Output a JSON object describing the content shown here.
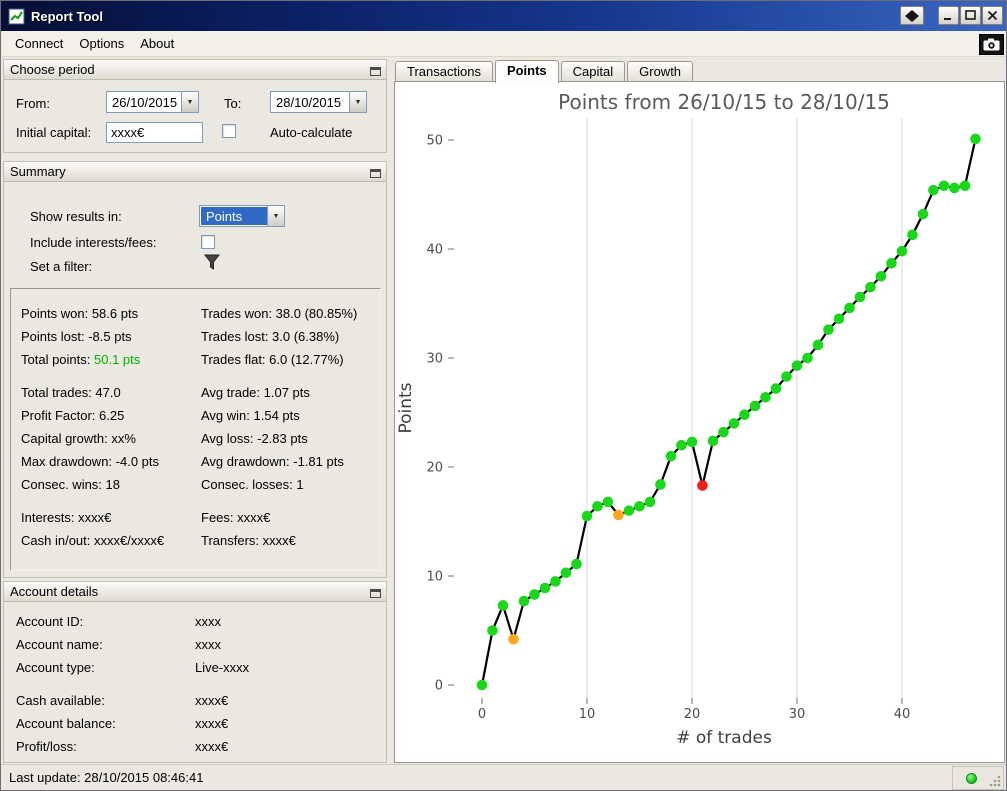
{
  "titlebar": {
    "title": "Report Tool"
  },
  "menubar": {
    "items": [
      "Connect",
      "Options",
      "About"
    ]
  },
  "choose_period": {
    "title": "Choose period",
    "from_label": "From:",
    "from_value": "26/10/2015",
    "to_label": "To:",
    "to_value": "28/10/2015",
    "initial_capital_label": "Initial capital:",
    "initial_capital_value": "xxxx€",
    "auto_calculate_label": "Auto-calculate",
    "auto_calculate_checked": false
  },
  "summary": {
    "title": "Summary",
    "show_results_label": "Show results in:",
    "show_results_value": "Points",
    "include_label": "Include interests/fees:",
    "include_checked": false,
    "filter_label": "Set a filter:",
    "stats_groups": [
      [
        [
          "Points won: 58.6 pts",
          "Trades won: 38.0 (80.85%)"
        ],
        [
          "Points lost: -8.5 pts",
          "Trades lost: 3.0 (6.38%)"
        ],
        [
          {
            "label": "Total points: ",
            "value": "50.1 pts",
            "value_color": "#00b400"
          },
          "Trades flat: 6.0 (12.77%)"
        ]
      ],
      [
        [
          "Total trades: 47.0",
          "Avg trade: 1.07 pts"
        ],
        [
          "Profit Factor: 6.25",
          "Avg win: 1.54 pts"
        ],
        [
          "Capital growth: xx%",
          "Avg loss: -2.83 pts"
        ],
        [
          "Max drawdown: -4.0 pts",
          "Avg drawdown: -1.81 pts"
        ],
        [
          "Consec. wins: 18",
          "Consec. losses: 1"
        ]
      ],
      [
        [
          "Interests: xxxx€",
          "Fees: xxxx€"
        ],
        [
          "Cash in/out: xxxx€/xxxx€",
          "Transfers: xxxx€"
        ]
      ]
    ]
  },
  "account_details": {
    "title": "Account details",
    "groups": [
      [
        {
          "label": "Account ID:",
          "value": "xxxx"
        },
        {
          "label": "Account name:",
          "value": "xxxx"
        },
        {
          "label": "Account type:",
          "value": "Live-xxxx"
        }
      ],
      [
        {
          "label": "Cash available:",
          "value": "xxxx€"
        },
        {
          "label": "Account balance:",
          "value": "xxxx€"
        },
        {
          "label": "Profit/loss:",
          "value": "xxxx€"
        }
      ]
    ]
  },
  "statusbar": {
    "last_update": "Last update: 28/10/2015 08:46:41"
  },
  "tabs": [
    {
      "label": "Transactions",
      "active": false
    },
    {
      "label": "Points",
      "active": true
    },
    {
      "label": "Capital",
      "active": false
    },
    {
      "label": "Growth",
      "active": false
    }
  ],
  "icons": {
    "app": "chart-app-icon",
    "window_extra": "diamond-dock-icon",
    "minimize": "minimize-icon",
    "maximize": "maximize-icon",
    "close": "close-icon",
    "screenshot": "camera-icon",
    "panel_float": "float-panel-icon",
    "dropdown": "chevron-down-icon",
    "filter": "funnel-icon",
    "status_led": "green-led-icon",
    "resize": "resize-grip-icon"
  },
  "colors": {
    "selection_blue": "#316ac5",
    "total_points_green": "#00b400",
    "led_green": "#2ed12e"
  },
  "chart_data": {
    "type": "line",
    "title": "Points from 26/10/15 to 28/10/15",
    "xlabel": "# of trades",
    "ylabel": "Points",
    "x_ticks": [
      0,
      10,
      20,
      30,
      40
    ],
    "y_ticks": [
      0,
      10,
      20,
      30,
      40,
      50
    ],
    "xlim": [
      -2.57,
      48.67
    ],
    "ylim": [
      -1.19,
      52.02
    ],
    "grid": "vertical-only",
    "legend": "none",
    "color_map": {
      "g": "#1bd71b",
      "o": "#ffa81f",
      "r": "#f11c1c",
      "line": "#000000"
    },
    "x": [
      0,
      1,
      2,
      3,
      4,
      5,
      6,
      7,
      8,
      9,
      10,
      11,
      12,
      13,
      14,
      15,
      16,
      17,
      18,
      19,
      20,
      21,
      22,
      23,
      24,
      25,
      26,
      27,
      28,
      29,
      30,
      31,
      32,
      33,
      34,
      35,
      36,
      37,
      38,
      39,
      40,
      41,
      42,
      43,
      44,
      45,
      46,
      47
    ],
    "y": [
      0.0,
      5.0,
      7.3,
      4.2,
      7.7,
      8.3,
      8.9,
      9.5,
      10.3,
      11.1,
      15.5,
      16.4,
      16.8,
      15.6,
      16.0,
      16.4,
      16.8,
      18.4,
      21.0,
      22.0,
      22.3,
      18.3,
      22.4,
      23.2,
      24.0,
      24.8,
      25.6,
      26.4,
      27.2,
      28.3,
      29.3,
      30.0,
      31.2,
      32.6,
      33.6,
      34.6,
      35.6,
      36.5,
      37.5,
      38.7,
      39.8,
      41.3,
      43.2,
      45.4,
      45.8,
      45.6,
      45.8,
      50.1
    ],
    "point_colors": [
      "g",
      "g",
      "g",
      "o",
      "g",
      "g",
      "g",
      "g",
      "g",
      "g",
      "g",
      "g",
      "g",
      "o",
      "g",
      "g",
      "g",
      "g",
      "g",
      "g",
      "g",
      "r",
      "g",
      "g",
      "g",
      "g",
      "g",
      "g",
      "g",
      "g",
      "g",
      "g",
      "g",
      "g",
      "g",
      "g",
      "g",
      "g",
      "g",
      "g",
      "g",
      "g",
      "g",
      "g",
      "g",
      "g",
      "g",
      "g"
    ]
  }
}
